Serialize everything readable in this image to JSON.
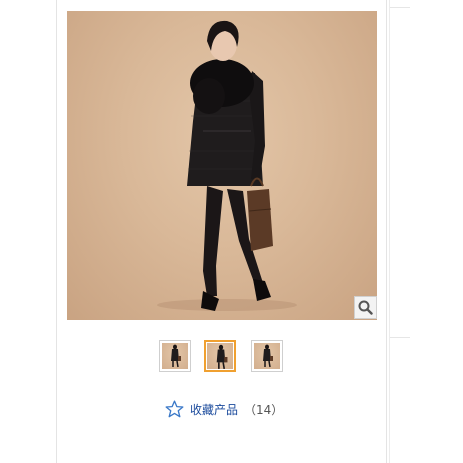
{
  "product": {
    "main_image_alt": "",
    "zoom": {
      "icon": "magnifier-icon"
    },
    "thumbnails": [
      {
        "selected": false
      },
      {
        "selected": true
      },
      {
        "selected": false
      }
    ],
    "favorite": {
      "icon": "star-outline-icon",
      "label": "收藏产品",
      "count": "（14）"
    }
  },
  "colors": {
    "backdrop": "#d9b898",
    "selected_border": "#f0a030",
    "link": "#1a4a9c",
    "star": "#3a78c8"
  }
}
